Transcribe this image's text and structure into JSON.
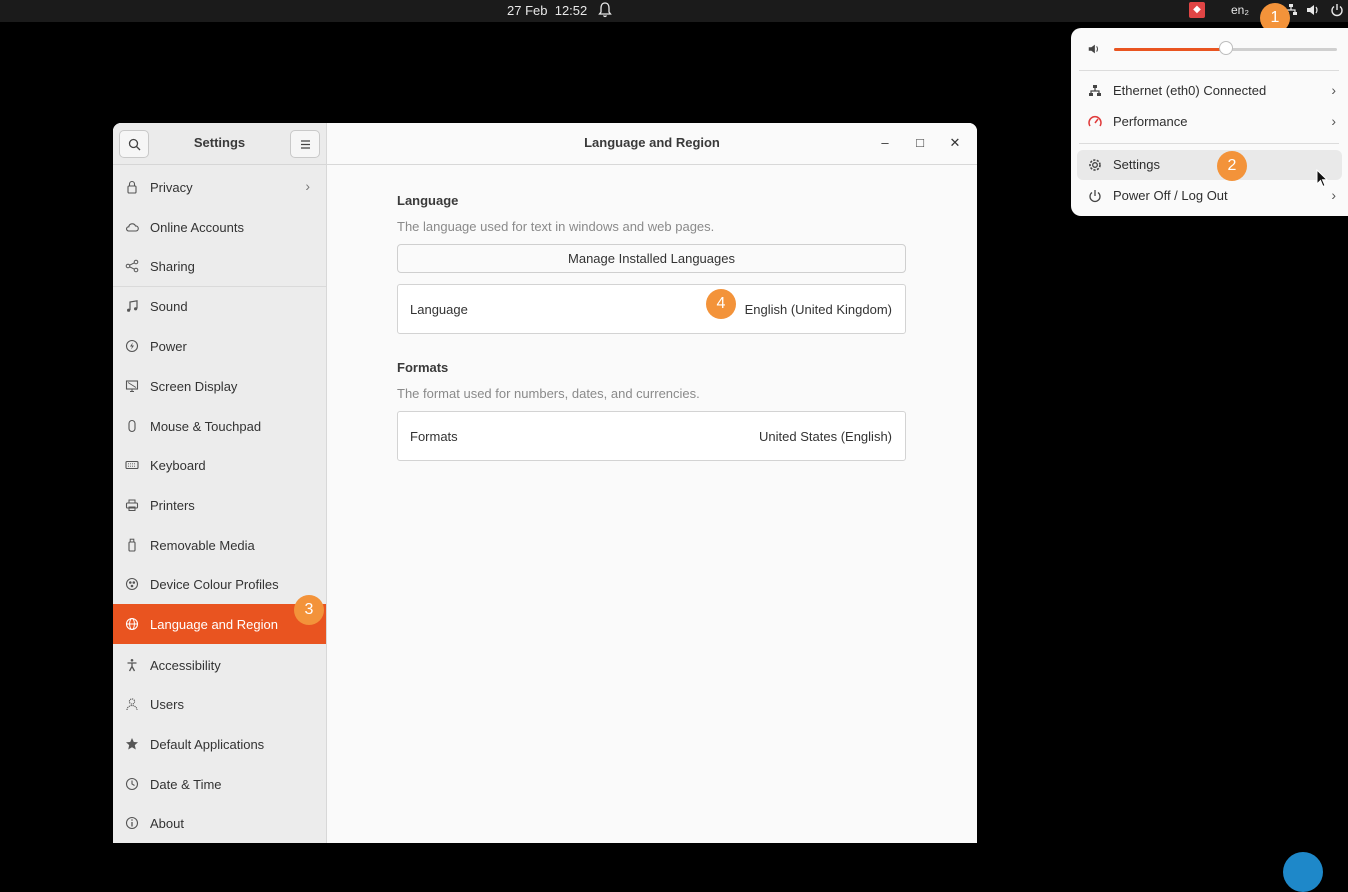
{
  "topbar": {
    "date": "27 Feb",
    "time": "12:52",
    "keyboard_layout": "en₂"
  },
  "annotations": [
    "1",
    "2",
    "3",
    "4"
  ],
  "quick_settings": {
    "volume_level": 0.5,
    "items": [
      {
        "label": "Ethernet (eth0) Connected",
        "icon": "network-wired-icon",
        "chevron": "›"
      },
      {
        "label": "Performance",
        "icon": "power-profile-icon",
        "chevron": "›"
      },
      {
        "label": "Settings",
        "icon": "gear-icon",
        "chevron": ""
      },
      {
        "label": "Power Off / Log Out",
        "icon": "power-icon",
        "chevron": "›"
      }
    ],
    "accent_color": "#e95420"
  },
  "window": {
    "sidebar_title": "Settings",
    "title": "Language and Region",
    "controls": {
      "minimize": "–",
      "maximize": "□",
      "close": "✕"
    }
  },
  "sidebar": {
    "items": [
      {
        "label": "Privacy",
        "icon": "lock-icon",
        "chevron": "›"
      },
      {
        "label": "Online Accounts",
        "icon": "cloud-icon"
      },
      {
        "label": "Sharing",
        "icon": "share-icon"
      },
      {
        "label": "Sound",
        "icon": "music-note-icon"
      },
      {
        "label": "Power",
        "icon": "power-bolt-icon"
      },
      {
        "label": "Screen Display",
        "icon": "display-icon"
      },
      {
        "label": "Mouse & Touchpad",
        "icon": "mouse-icon"
      },
      {
        "label": "Keyboard",
        "icon": "keyboard-icon"
      },
      {
        "label": "Printers",
        "icon": "printer-icon"
      },
      {
        "label": "Removable Media",
        "icon": "usb-icon"
      },
      {
        "label": "Device Colour Profiles",
        "icon": "colour-icon"
      },
      {
        "label": "Language and Region",
        "icon": "globe-icon",
        "active": true
      },
      {
        "label": "Accessibility",
        "icon": "accessibility-icon"
      },
      {
        "label": "Users",
        "icon": "user-icon"
      },
      {
        "label": "Default Applications",
        "icon": "star-icon"
      },
      {
        "label": "Date & Time",
        "icon": "clock-icon"
      },
      {
        "label": "About",
        "icon": "info-icon"
      }
    ]
  },
  "content": {
    "language_section": {
      "title": "Language",
      "description": "The language used for text in windows and web pages.",
      "manage_button": "Manage Installed Languages",
      "row_label": "Language",
      "row_value": "English (United Kingdom)"
    },
    "formats_section": {
      "title": "Formats",
      "description": "The format used for numbers, dates, and currencies.",
      "row_label": "Formats",
      "row_value": "United States (English)"
    }
  }
}
